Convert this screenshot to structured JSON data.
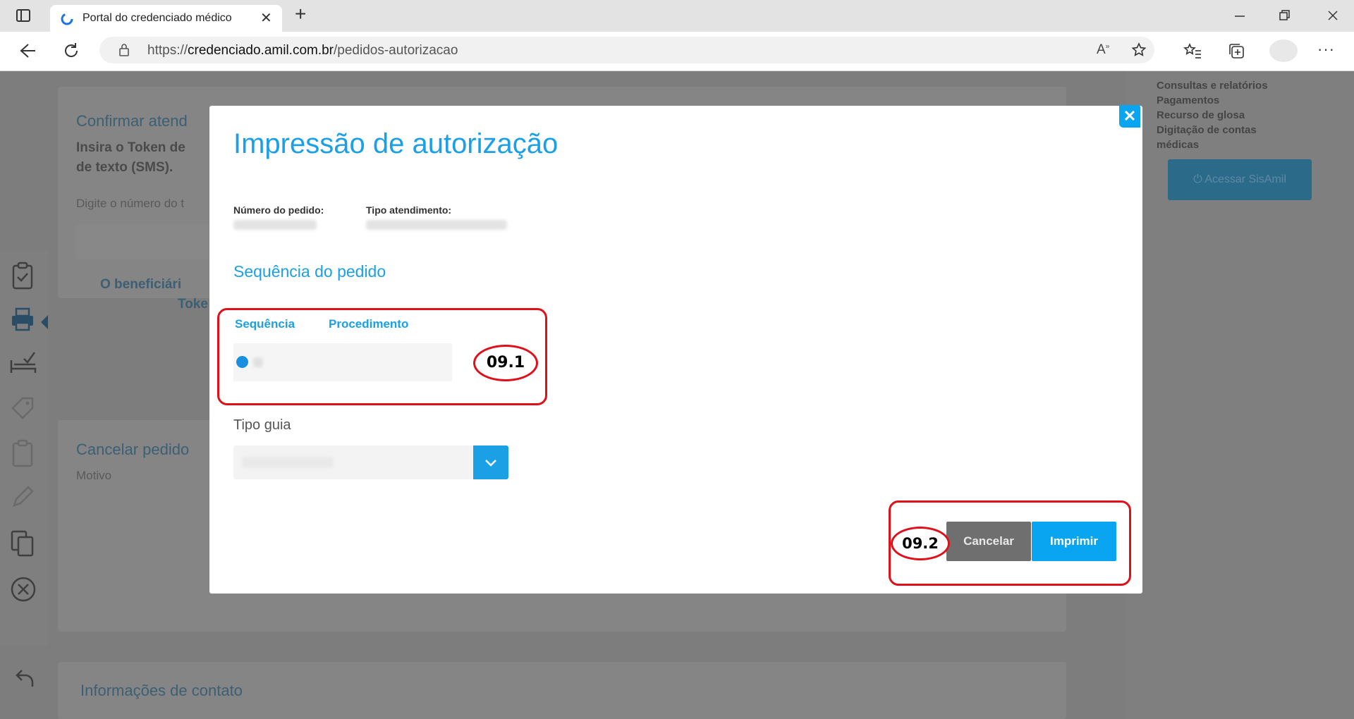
{
  "browser": {
    "tab_title": "Portal do credenciado médico",
    "tab_close": "✕",
    "new_tab": "+",
    "url_scheme": "https://",
    "url_host": "credenciado.amil.com.br",
    "url_path": "/pedidos-autorizacao",
    "icons": [
      "sidebar-toggle-icon",
      "back-icon",
      "refresh-icon",
      "lock-icon",
      "read-aloud-icon",
      "favorite-add-icon",
      "favorites-icon",
      "collections-icon",
      "profile-icon",
      "more-icon",
      "minimize-icon",
      "restore-icon",
      "close-window-icon"
    ]
  },
  "background_page": {
    "confirm_title": "Confirmar atend",
    "confirm_text_1": "Insira o Token de",
    "confirm_text_2": "de texto (SMS).",
    "digit_label": "Digite o número do t",
    "beneficiary_1": "O beneficiári",
    "beneficiary_2": "Toke",
    "cancel_title": "Cancelar pedido",
    "motivo_label": "Motivo",
    "contact_title": "Informações de contato",
    "right_links": [
      "Consultas e relatórios",
      "Pagamentos",
      "Recurso de glosa",
      "Digitação de contas",
      "médicas"
    ],
    "sisamil_button": "Acessar SisAmil"
  },
  "modal": {
    "close": "✕",
    "title": "Impressão de autorização",
    "order_number_label": "Número do pedido:",
    "service_type_label": "Tipo atendimento:",
    "section_title": "Sequência do pedido",
    "table_headers": [
      "Sequência",
      "Procedimento"
    ],
    "tipo_guia_label": "Tipo guia",
    "select_arrow": "⌄",
    "cancel_button": "Cancelar",
    "print_button": "Imprimir"
  },
  "annotations": {
    "marker_1": "09.1",
    "marker_2": "09.2",
    "color": "#e0101a"
  },
  "colors": {
    "accent": "#1ba0e6",
    "print_button": "#0aa5f0",
    "cancel_button": "#6f6f6f"
  }
}
